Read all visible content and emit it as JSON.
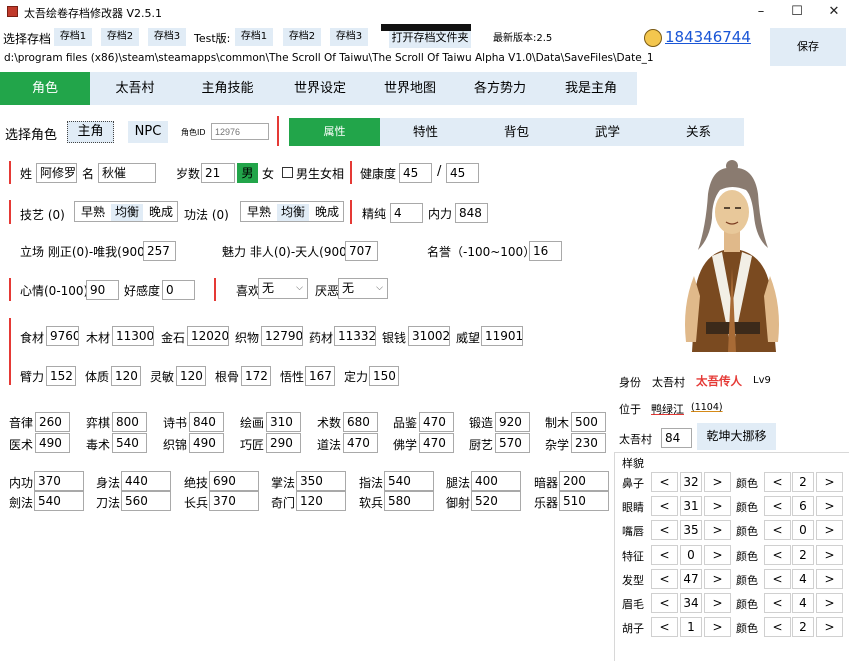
{
  "window": {
    "title": "太吾绘卷存档修改器 V2.5.1",
    "controls": {
      "minimize": "–",
      "maximize": "☐",
      "close": "✕"
    }
  },
  "toolbar": {
    "select_save_label": "选择存档",
    "saves": [
      "存档1",
      "存档2",
      "存档3"
    ],
    "test_label": "Test版:",
    "test_saves": [
      "存档1",
      "存档2",
      "存档3"
    ],
    "open_folder": "打开存档文件夹",
    "latest_version": "最新版本:2.5",
    "qq_number": "184346744",
    "save_button": "保存",
    "path": "d:\\program files (x86)\\steam\\steamapps\\common\\The Scroll Of Taiwu\\The Scroll Of Taiwu Alpha V1.0\\Data\\SaveFiles\\Date_1"
  },
  "main_tabs": [
    "角色",
    "太吾村",
    "主角技能",
    "世界设定",
    "世界地图",
    "各方势力",
    "我是主角"
  ],
  "role_select": {
    "label": "选择角色",
    "protagonist": "主角",
    "npc": "NPC",
    "role_id_label": "角色ID",
    "role_id_placeholder": "12976"
  },
  "sub_tabs": [
    "属性",
    "特性",
    "背包",
    "武学",
    "关系"
  ],
  "basic": {
    "surname_label": "姓",
    "surname": "阿修罗",
    "name_label": "名",
    "name": "秋催",
    "age_label": "岁数",
    "age": "21",
    "male": "男",
    "female": "女",
    "male_female_look": "男生女相",
    "health_label": "健康度",
    "health": "45",
    "health_sep": "/",
    "health_max": "45"
  },
  "skills": {
    "art_label": "技艺 (0)",
    "growth_options": [
      "早熟",
      "均衡",
      "晚成"
    ],
    "kungfu_label": "功法 (0)",
    "essence_label": "精纯",
    "essence": "4",
    "neili_label": "内力",
    "neili": "848"
  },
  "stance": {
    "label": "立场 刚正(0)-唯我(900)",
    "value": "257",
    "charm_label": "魅力 非人(0)-天人(900)",
    "charm": "707",
    "fame_label": "名誉（-100~100）",
    "fame": "16"
  },
  "mood": {
    "label": "心情(0-100)",
    "value": "90",
    "favor_label": "好感度",
    "favor": "0",
    "like_label": "喜欢",
    "like": "无",
    "dislike_label": "厌恶",
    "dislike": "无"
  },
  "resources": [
    {
      "label": "食材",
      "value": "9760"
    },
    {
      "label": "木材",
      "value": "11300"
    },
    {
      "label": "金石",
      "value": "12020"
    },
    {
      "label": "织物",
      "value": "12790"
    },
    {
      "label": "药材",
      "value": "11332"
    },
    {
      "label": "银钱",
      "value": "31002"
    },
    {
      "label": "威望",
      "value": "11901"
    }
  ],
  "attributes": [
    {
      "label": "臂力",
      "value": "152"
    },
    {
      "label": "体质",
      "value": "120"
    },
    {
      "label": "灵敏",
      "value": "120"
    },
    {
      "label": "根骨",
      "value": "172"
    },
    {
      "label": "悟性",
      "value": "167"
    },
    {
      "label": "定力",
      "value": "150"
    }
  ],
  "life_skills": [
    {
      "label": "音律",
      "value": "260"
    },
    {
      "label": "弈棋",
      "value": "800"
    },
    {
      "label": "诗书",
      "value": "840"
    },
    {
      "label": "绘画",
      "value": "310"
    },
    {
      "label": "术数",
      "value": "680"
    },
    {
      "label": "品鉴",
      "value": "470"
    },
    {
      "label": "锻造",
      "value": "920"
    },
    {
      "label": "制木",
      "value": "500"
    },
    {
      "label": "医术",
      "value": "490"
    },
    {
      "label": "毒术",
      "value": "540"
    },
    {
      "label": "织锦",
      "value": "490"
    },
    {
      "label": "巧匠",
      "value": "290"
    },
    {
      "label": "道法",
      "value": "470"
    },
    {
      "label": "佛学",
      "value": "470"
    },
    {
      "label": "厨艺",
      "value": "570"
    },
    {
      "label": "杂学",
      "value": "230"
    }
  ],
  "combat_skills": [
    {
      "label": "内功",
      "value": "370"
    },
    {
      "label": "身法",
      "value": "440"
    },
    {
      "label": "绝技",
      "value": "690"
    },
    {
      "label": "掌法",
      "value": "350"
    },
    {
      "label": "指法",
      "value": "540"
    },
    {
      "label": "腿法",
      "value": "400"
    },
    {
      "label": "暗器",
      "value": "200"
    },
    {
      "label": "劍法",
      "value": "540"
    },
    {
      "label": "刀法",
      "value": "560"
    },
    {
      "label": "长兵",
      "value": "370"
    },
    {
      "label": "奇门",
      "value": "120"
    },
    {
      "label": "软兵",
      "value": "580"
    },
    {
      "label": "御射",
      "value": "520"
    },
    {
      "label": "乐器",
      "value": "510"
    }
  ],
  "identity": {
    "status_label": "身份",
    "village": "太吾村",
    "title": "太吾传人",
    "level": "Lv9",
    "location_label": "位于",
    "location": "鸭绿江",
    "location_id": "(1104)",
    "village_label": "太吾村",
    "village_value": "84",
    "move_button": "乾坤大挪移"
  },
  "appearance": {
    "title": "样貌",
    "color_label": "颜色",
    "prev": "<",
    "next": ">",
    "rows": [
      {
        "label": "鼻子",
        "value": "32",
        "color": "2"
      },
      {
        "label": "眼睛",
        "value": "31",
        "color": "6"
      },
      {
        "label": "嘴唇",
        "value": "35",
        "color": "0"
      },
      {
        "label": "特征",
        "value": "0",
        "color": "2"
      },
      {
        "label": "发型",
        "value": "47",
        "color": "4"
      },
      {
        "label": "眉毛",
        "value": "34",
        "color": "4"
      },
      {
        "label": "胡子",
        "value": "1",
        "color": "2"
      }
    ]
  },
  "colors": {
    "accent": "#22a54a",
    "tab_bg": "#e1ecf6",
    "red": "#e53935",
    "link": "#1a56d6"
  }
}
